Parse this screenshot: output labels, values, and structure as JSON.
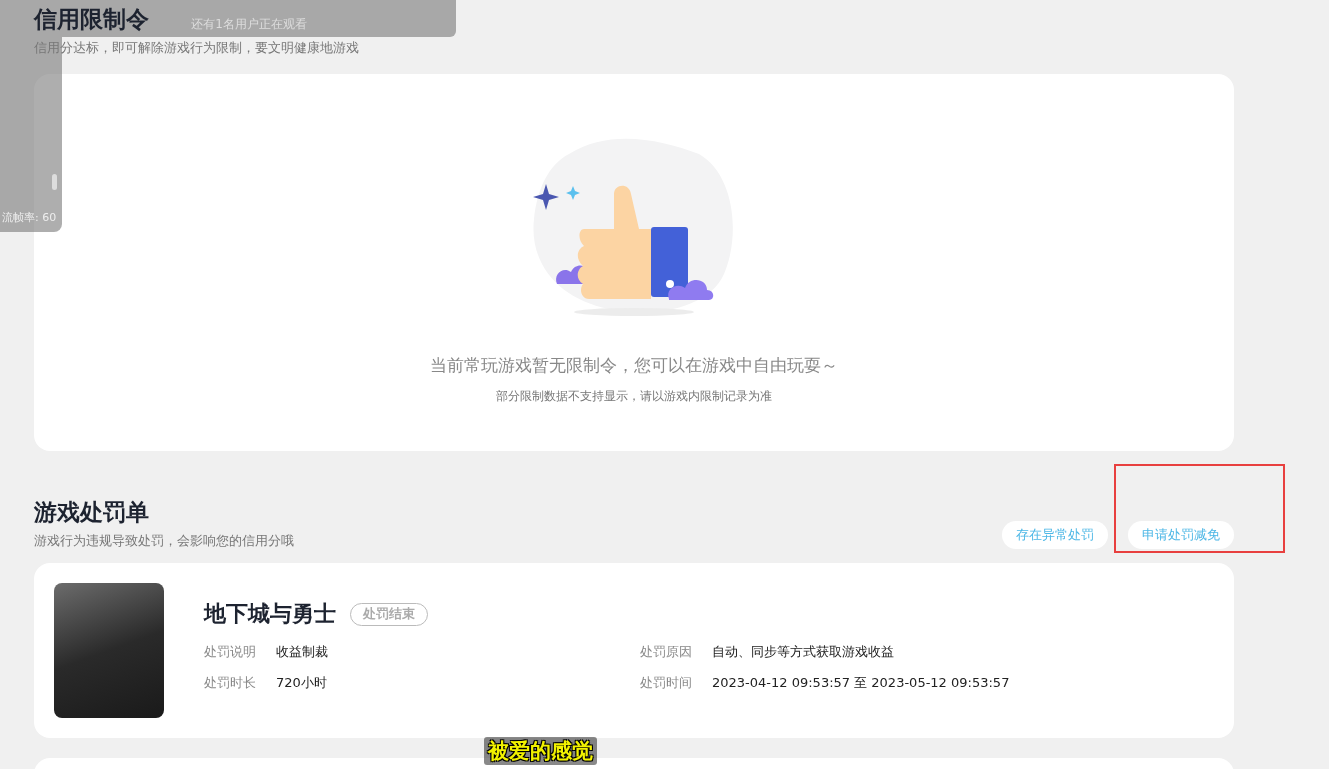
{
  "restrictions": {
    "title": "信用限制令",
    "subtitle": "信用分达标，即可解除游戏行为限制，要文明健康地游戏",
    "empty_message": "当前常玩游戏暂无限制令，您可以在游戏中自由玩耍～",
    "empty_note": "部分限制数据不支持显示，请以游戏内限制记录为准"
  },
  "penalties": {
    "title": "游戏处罚单",
    "subtitle": "游戏行为违规导致处罚，会影响您的信用分哦",
    "actions": [
      {
        "label": "存在异常处罚",
        "annotated": false
      },
      {
        "label": "申请处罚减免",
        "annotated": true
      }
    ],
    "records": [
      {
        "game": "地下城与勇士",
        "status": "处罚结束",
        "fields": [
          {
            "label": "处罚说明",
            "value": "收益制裁"
          },
          {
            "label": "处罚原因",
            "value": "自动、同步等方式获取游戏收益"
          },
          {
            "label": "处罚时长",
            "value": "720小时"
          },
          {
            "label": "处罚时间",
            "value": "2023-04-12 09:53:57 至 2023-05-12 09:53:57"
          }
        ]
      }
    ]
  },
  "overlay": {
    "viewer_notice": "还有1名用户正在观看",
    "frame_rate": "流帧率: 60"
  },
  "caption": "被爱的感觉"
}
